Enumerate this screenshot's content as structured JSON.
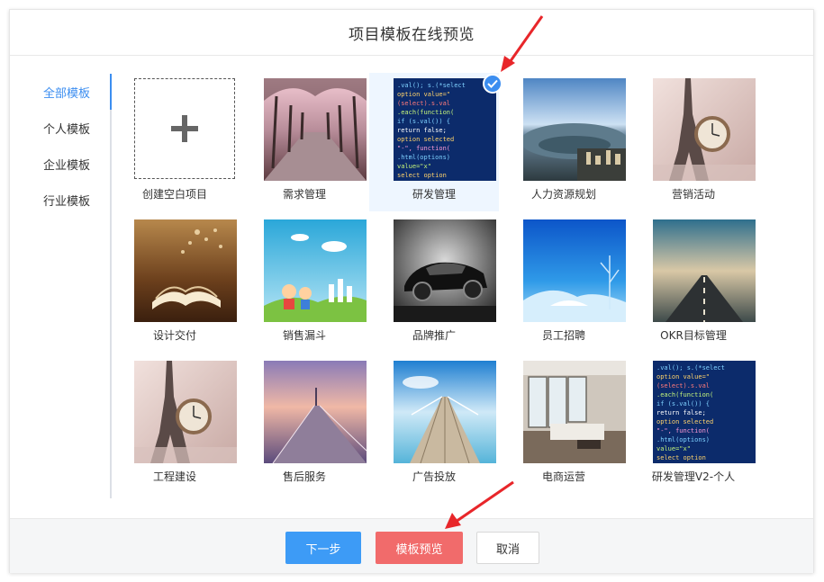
{
  "dialog": {
    "title": "项目模板在线预览"
  },
  "sidebar": {
    "items": [
      {
        "label": "全部模板",
        "active": true
      },
      {
        "label": "个人模板",
        "active": false
      },
      {
        "label": "企业模板",
        "active": false
      },
      {
        "label": "行业模板",
        "active": false
      }
    ]
  },
  "templates": [
    {
      "label": "创建空白项目",
      "icon": "plus-icon"
    },
    {
      "label": "需求管理"
    },
    {
      "label": "研发管理",
      "selected": true,
      "badge_icon": "check-icon"
    },
    {
      "label": "人力资源规划"
    },
    {
      "label": "营销活动"
    },
    {
      "label": "设计交付"
    },
    {
      "label": "销售漏斗"
    },
    {
      "label": "品牌推广"
    },
    {
      "label": "员工招聘"
    },
    {
      "label": "OKR目标管理"
    },
    {
      "label": "工程建设"
    },
    {
      "label": "售后服务"
    },
    {
      "label": "广告投放"
    },
    {
      "label": "电商运营"
    },
    {
      "label": "研发管理V2-个人"
    }
  ],
  "footer": {
    "next_label": "下一步",
    "preview_label": "模板预览",
    "cancel_label": "取消"
  },
  "colors": {
    "accent": "#3c8ef0",
    "next_button": "#3d9bf6",
    "preview_button": "#f16b6b",
    "annotation_arrow": "#e8262a"
  }
}
